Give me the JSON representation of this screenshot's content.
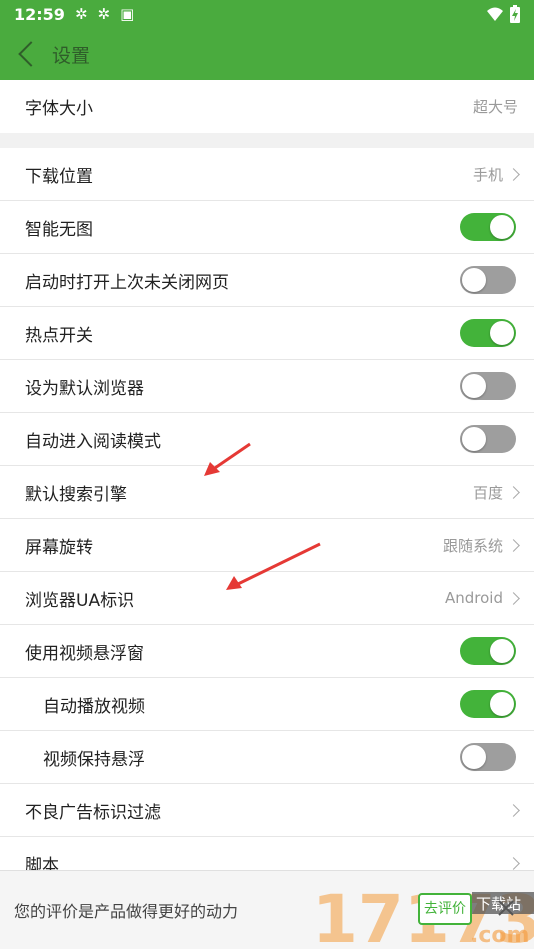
{
  "status_bar": {
    "time": "12:59",
    "battery_icon": "battery-charging-icon",
    "wifi_icon": "wifi-icon"
  },
  "header": {
    "title": "设置",
    "back_icon": "chevron-left-icon"
  },
  "font_size": {
    "label": "字体大小",
    "value": "超大号"
  },
  "settings": [
    {
      "label": "下载位置",
      "value": "手机",
      "type": "link"
    },
    {
      "label": "智能无图",
      "type": "toggle",
      "on": true
    },
    {
      "label": "启动时打开上次未关闭网页",
      "type": "toggle",
      "on": false
    },
    {
      "label": "热点开关",
      "type": "toggle",
      "on": true
    },
    {
      "label": "设为默认浏览器",
      "type": "toggle",
      "on": false
    },
    {
      "label": "自动进入阅读模式",
      "type": "toggle",
      "on": false
    },
    {
      "label": "默认搜索引擎",
      "value": "百度",
      "type": "link"
    },
    {
      "label": "屏幕旋转",
      "value": "跟随系统",
      "type": "link"
    },
    {
      "label": "浏览器UA标识",
      "value": "Android",
      "type": "link"
    },
    {
      "label": "使用视频悬浮窗",
      "type": "toggle",
      "on": true
    },
    {
      "label": "自动播放视频",
      "type": "toggle",
      "on": true,
      "sub": true
    },
    {
      "label": "视频保持悬浮",
      "type": "toggle",
      "on": false,
      "sub": true
    },
    {
      "label": "不良广告标识过滤",
      "type": "link",
      "value": ""
    },
    {
      "label": "脚本",
      "type": "link",
      "value": ""
    }
  ],
  "rating_bar": {
    "message": "您的评价是产品做得更好的动力",
    "button": "去评价"
  },
  "watermark": {
    "text": "17173",
    "sub": "下载站",
    "domain": ".com"
  },
  "colors": {
    "accent": "#4aab3e",
    "toggle_on": "#43b33a",
    "toggle_off": "#9e9e9e",
    "arrow": "#e53935"
  }
}
